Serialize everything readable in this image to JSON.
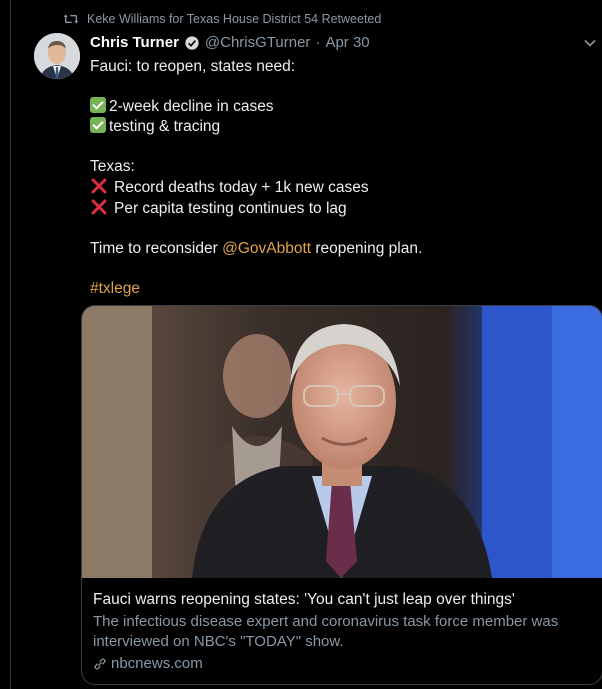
{
  "retweet": {
    "text": "Keke Williams for Texas House District 54 Retweeted",
    "icon": "retweet-icon"
  },
  "author": {
    "name": "Chris Turner",
    "handle": "@ChrisGTurner",
    "separator": "·",
    "date": "Apr 30",
    "verified_icon": "verified-badge-icon"
  },
  "tweet": {
    "line1": "Fauci: to reopen, states need:",
    "need1": "2-week decline in cases",
    "need2": "testing & tracing",
    "texas_label": "Texas:",
    "issue1": "Record deaths today + 1k new cases",
    "issue2": "Per capita testing continues to lag",
    "closing_pre": "Time to reconsider ",
    "mention": "@GovAbbott",
    "closing_post": " reopening plan.",
    "hashtag": "#txlege"
  },
  "card": {
    "title": "Fauci warns reopening states: 'You can't just leap over things'",
    "description": "The infectious disease expert and coronavirus task force member was interviewed on NBC's \"TODAY\" show.",
    "domain": "nbcnews.com"
  },
  "colors": {
    "background": "#000000",
    "link": "#e0a345",
    "secondary_text": "#8899a6",
    "check_green": "#77b255",
    "cross_red": "#dd2e44"
  }
}
